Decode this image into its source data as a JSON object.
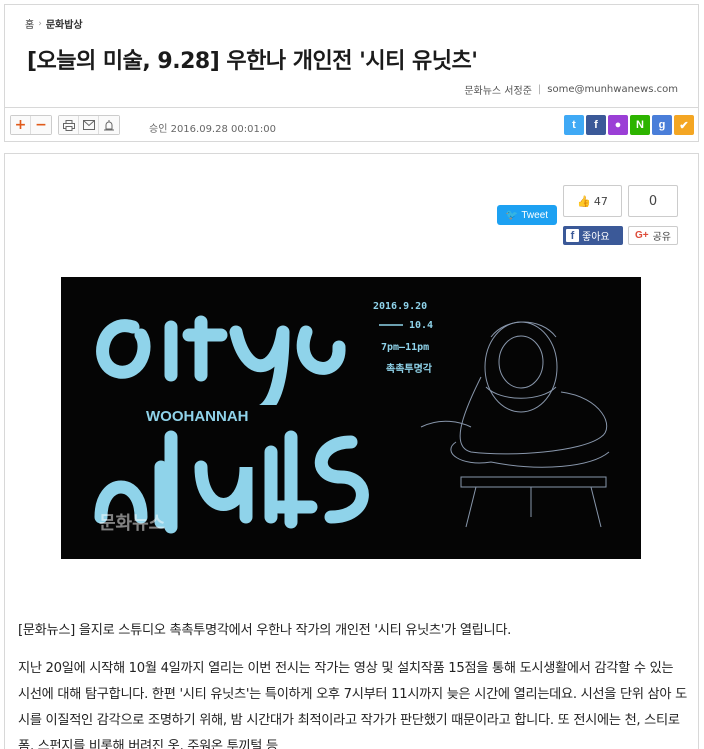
{
  "breadcrumb": {
    "home": "홈",
    "section": "문화밥상"
  },
  "article": {
    "title": "[오늘의 미술, 9.28] 우한나 개인전 '시티 유닛츠'",
    "author": "문화뉴스 서정준",
    "email": "some@munhwanews.com",
    "date": "승인 2016.09.28  00:01:00"
  },
  "toolbar": {
    "font_increase": "+",
    "font_decrease": "−",
    "print_icon": "print-icon",
    "email_icon": "email-icon",
    "report_icon": "report-icon"
  },
  "share_icons": [
    {
      "name": "twitter",
      "glyph": "t",
      "color": "#3fa9f5"
    },
    {
      "name": "facebook",
      "glyph": "f",
      "color": "#3b5998"
    },
    {
      "name": "kakaostory",
      "glyph": "●",
      "color": "#9b3fd6"
    },
    {
      "name": "naver",
      "glyph": "N",
      "color": "#2db400"
    },
    {
      "name": "google",
      "glyph": "g",
      "color": "#4a7ed9"
    },
    {
      "name": "bookmark",
      "glyph": "✔",
      "color": "#f4a623"
    }
  ],
  "social": {
    "tweet_label": "Tweet",
    "fb_count": "47",
    "fb_like_label": "좋아요",
    "gplus_count": "0",
    "gplus_label": "공유"
  },
  "poster": {
    "dates": "2016.9.20",
    "dates_end": "10.4",
    "time": "7pm–11pm",
    "venue": "촉촉투명각",
    "artist": "WOOHANNAH",
    "watermark": "문화뉴스",
    "colors": {
      "accent": "#8fd3ea",
      "background": "#050505"
    }
  },
  "body": {
    "p1": "[문화뉴스] 을지로 스튜디오 촉촉투명각에서 우한나 작가의 개인전 '시티 유닛츠'가 열립니다.",
    "p2": "지난 20일에 시작해 10월 4일까지 열리는 이번 전시는 작가는 영상 및 설치작품 15점을 통해 도시생활에서 감각할 수 있는 시선에 대해 탐구합니다. 한편 '시티 유닛츠'는 특이하게 오후 7시부터 11시까지 늦은 시간에 열리는데요. 시선을 단위 삼아 도시를 이질적인 감각으로 조명하기 위해, 밤 시간대가 최적이라고 작가가 판단했기 때문이라고 합니다. 또 전시에는 천, 스티로폼, 스펀지를 비롯해 버려진 옷, 주워온 투끼털 등"
  }
}
